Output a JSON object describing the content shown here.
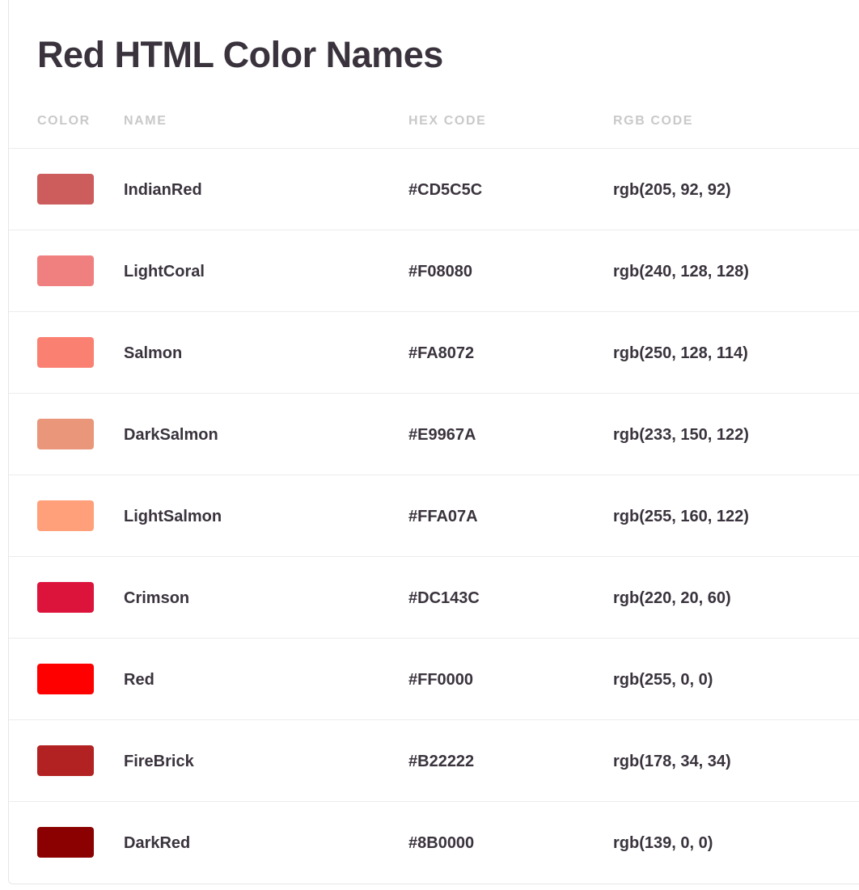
{
  "page": {
    "title": "Red HTML Color Names"
  },
  "table": {
    "headers": {
      "color": "COLOR",
      "name": "NAME",
      "hex": "HEX CODE",
      "rgb": "RGB CODE"
    },
    "rows": [
      {
        "name": "IndianRed",
        "hex": "#CD5C5C",
        "rgb": "rgb(205, 92, 92)",
        "swatch": "#CD5C5C"
      },
      {
        "name": "LightCoral",
        "hex": "#F08080",
        "rgb": "rgb(240, 128, 128)",
        "swatch": "#F08080"
      },
      {
        "name": "Salmon",
        "hex": "#FA8072",
        "rgb": "rgb(250, 128, 114)",
        "swatch": "#FA8072"
      },
      {
        "name": "DarkSalmon",
        "hex": "#E9967A",
        "rgb": "rgb(233, 150, 122)",
        "swatch": "#E9967A"
      },
      {
        "name": "LightSalmon",
        "hex": "#FFA07A",
        "rgb": "rgb(255, 160, 122)",
        "swatch": "#FFA07A"
      },
      {
        "name": "Crimson",
        "hex": "#DC143C",
        "rgb": "rgb(220, 20, 60)",
        "swatch": "#DC143C"
      },
      {
        "name": "Red",
        "hex": "#FF0000",
        "rgb": "rgb(255, 0, 0)",
        "swatch": "#FF0000"
      },
      {
        "name": "FireBrick",
        "hex": "#B22222",
        "rgb": "rgb(178, 34, 34)",
        "swatch": "#B22222"
      },
      {
        "name": "DarkRed",
        "hex": "#8B0000",
        "rgb": "rgb(139, 0, 0)",
        "swatch": "#8B0000"
      }
    ]
  },
  "colors": {
    "title_text": "#3a333d",
    "header_text": "#c9c9c9",
    "cell_text": "#3a333d",
    "divider": "#ececec"
  }
}
